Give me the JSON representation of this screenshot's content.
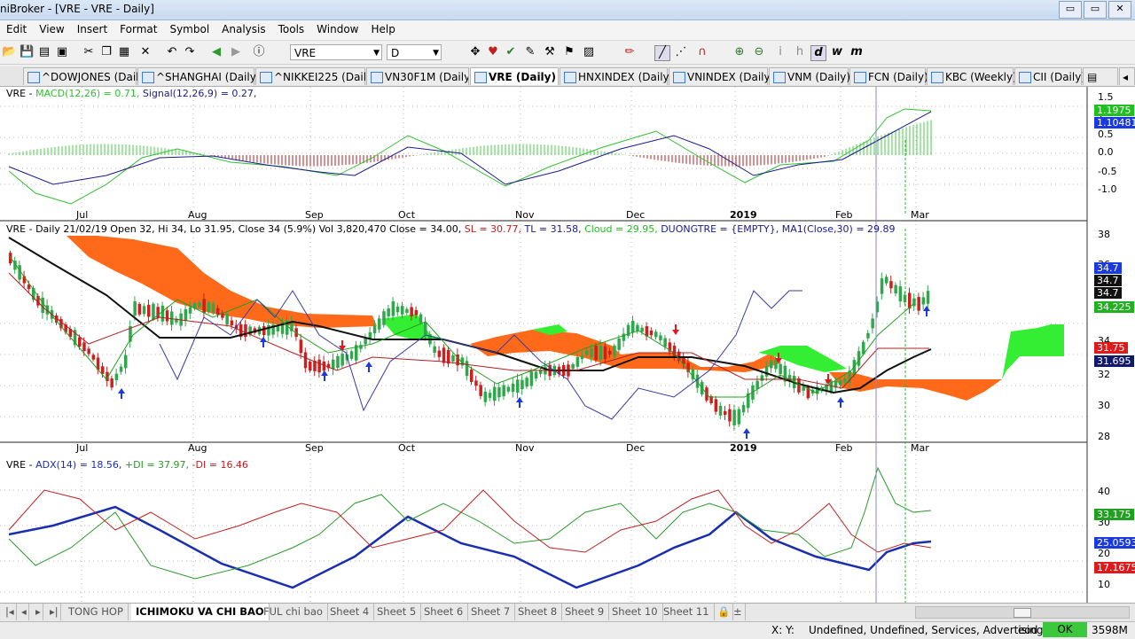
{
  "title": "niBroker - [VRE - VRE - Daily]",
  "window_buttons": [
    "▭",
    "▭",
    "✕"
  ],
  "menu": [
    "Edit",
    "View",
    "Insert",
    "Format",
    "Symbol",
    "Analysis",
    "Tools",
    "Window",
    "Help"
  ],
  "toolbar": {
    "symbol_value": "VRE",
    "interval_value": "D"
  },
  "tabs": [
    "^DOWJONES (Daily)",
    "^SHANGHAI (Daily)",
    "^NIKKEI225 (Daily)",
    "VN30F1M (Daily)",
    "VRE (Daily)",
    "HNXINDEX (Daily)",
    "VNINDEX (Daily)",
    "VNM (Daily)",
    "FCN (Daily)",
    "KBC (Weekly)",
    "CII (Daily)"
  ],
  "tab_close": "✕",
  "panels": {
    "macd": {
      "prefix": "VRE - ",
      "macd_label": "MACD(12,26) = 0.71,",
      "signal_label": "Signal(12,26,9) = 0.27,",
      "axis": [
        "1.5",
        "1",
        "0.5",
        "0.0",
        "-0.5",
        "-1.0"
      ],
      "box_macd": "1.1975",
      "box_signal": "1.10481"
    },
    "price": {
      "label_a": "VRE - Daily 21/02/19 Open 32, Hi 34, Lo 31.95, Close 34 (5.9%) Vol 3,820,470 Close = 34.00,",
      "label_sl": "SL = 30.77,",
      "label_tl": "TL = 31.58,",
      "label_cloud": "Cloud = 29.95,",
      "label_duong": "DUONGTRE = {EMPTY},",
      "label_ma": "MA1(Close,30) = 29.89",
      "axis": [
        "38",
        "36",
        "34",
        "32",
        "30",
        "28"
      ],
      "boxes": [
        "34.7",
        "34.7",
        "34.7",
        "34.225",
        "31.75",
        "31.695"
      ]
    },
    "adx": {
      "prefix": "VRE - ",
      "adx_label": "ADX(14) = 18.56,",
      "pdi_label": "+DI = 37.97,",
      "mdi_label": "-DI = 16.46",
      "axis": [
        "40",
        "30",
        "20",
        "10"
      ],
      "boxes": [
        "33.175",
        "25.0593",
        "17.1675"
      ]
    }
  },
  "months": [
    "Jul",
    "Aug",
    "Sep",
    "Oct",
    "Nov",
    "Dec",
    "2019",
    "Feb",
    "Mar"
  ],
  "sheets": [
    "TONG HOP",
    "ICHIMOKU VA CHI BAO",
    "FUL chi bao",
    "Sheet 4",
    "Sheet 5",
    "Sheet 6",
    "Sheet 7",
    "Sheet 8",
    "Sheet 9",
    "Sheet 10",
    "Sheet 11"
  ],
  "status": {
    "xy": "X:  Y:",
    "info": "Undefined, Undefined, Services, Advertising",
    "mode": "eod",
    "ok": "OK",
    "mem": "3598M"
  },
  "colors": {
    "cloud_orange": "#ff6a1a",
    "cloud_green": "#33ee33",
    "up_candle": "#2ea84a",
    "down_candle": "#cc1f1f",
    "macd_line": "#30c030",
    "signal_line": "#1a1a8c",
    "adx_line": "#1a2fb0",
    "pdi_line": "#2a9a2a",
    "mdi_line": "#c02020"
  }
}
